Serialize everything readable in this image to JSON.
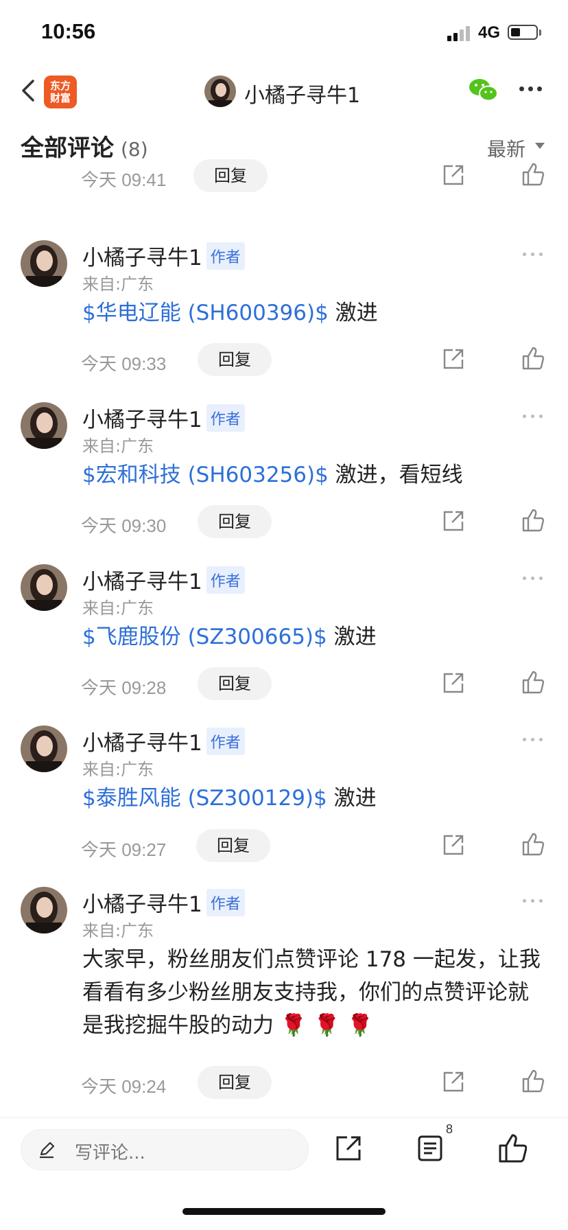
{
  "status": {
    "time": "10:56",
    "network": "4G"
  },
  "nav": {
    "logo_line1": "东方",
    "logo_line2": "财富",
    "title": "小橘子寻牛1"
  },
  "section": {
    "title": "全部评论",
    "count": "(8)",
    "sort": "最新"
  },
  "first_meta": {
    "time": "今天 09:41",
    "reply": "回复"
  },
  "comments": [
    {
      "author": "小橘子寻牛1",
      "badge": "作者",
      "location": "来自:广东",
      "stock": "$华电辽能 (SH600396)$",
      "text": " 激进",
      "time": "今天 09:33",
      "reply": "回复"
    },
    {
      "author": "小橘子寻牛1",
      "badge": "作者",
      "location": "来自:广东",
      "stock": "$宏和科技 (SH603256)$",
      "text": " 激进，看短线",
      "time": "今天 09:30",
      "reply": "回复"
    },
    {
      "author": "小橘子寻牛1",
      "badge": "作者",
      "location": "来自:广东",
      "stock": "$飞鹿股份 (SZ300665)$",
      "text": " 激进",
      "time": "今天 09:28",
      "reply": "回复"
    },
    {
      "author": "小橘子寻牛1",
      "badge": "作者",
      "location": "来自:广东",
      "stock": "$泰胜风能 (SZ300129)$",
      "text": " 激进",
      "time": "今天 09:27",
      "reply": "回复"
    },
    {
      "author": "小橘子寻牛1",
      "badge": "作者",
      "location": "来自:广东",
      "stock": "",
      "text": "大家早，粉丝朋友们点赞评论 178 一起发，让我看看有多少粉丝朋友支持我，你们的点赞评论就是我挖掘牛股的动力 🌹 🌹 🌹",
      "time": "今天 09:24",
      "reply": "回复"
    }
  ],
  "bottom": {
    "placeholder": "写评论...",
    "comment_count": "8"
  },
  "colors": {
    "stock_link": "#2d6fd8",
    "badge_bg": "#e8f0fd",
    "logo": "#ee5a24",
    "wechat": "#52c41a"
  }
}
